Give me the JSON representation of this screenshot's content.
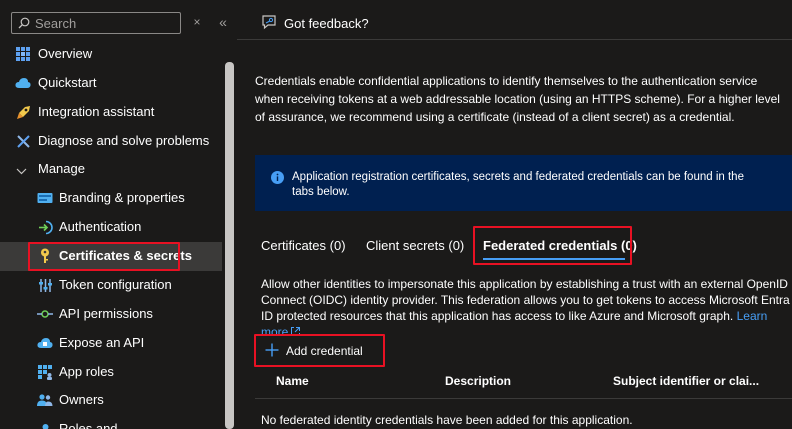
{
  "sidebar": {
    "search_placeholder": "Search",
    "close_glyph": "×",
    "collapse_glyph": "«",
    "items": [
      {
        "label": "Overview"
      },
      {
        "label": "Quickstart"
      },
      {
        "label": "Integration assistant"
      },
      {
        "label": "Diagnose and solve problems"
      },
      {
        "label": "Manage"
      },
      {
        "label": "Branding & properties"
      },
      {
        "label": "Authentication"
      },
      {
        "label": "Certificates & secrets"
      },
      {
        "label": "Token configuration"
      },
      {
        "label": "API permissions"
      },
      {
        "label": "Expose an API"
      },
      {
        "label": "App roles"
      },
      {
        "label": "Owners"
      },
      {
        "label": "Roles and"
      }
    ]
  },
  "main": {
    "feedback_label": "Got feedback?",
    "intro": "Credentials enable confidential applications to identify themselves to the authentication service when receiving tokens at a web addressable location (using an HTTPS scheme). For a higher level of assurance, we recommend using a certificate (instead of a client secret) as a credential.",
    "info_bar": {
      "text": "Application registration certificates, secrets and federated credentials can be found in the tabs below.",
      "close": "✕"
    },
    "tabs": [
      {
        "label": "Certificates (0)"
      },
      {
        "label": "Client secrets (0)"
      },
      {
        "label": "Federated credentials (0)"
      }
    ],
    "federated_description": "Allow other identities to impersonate this application by establishing a trust with an external OpenID Connect (OIDC) identity provider. This federation allows you to get tokens to access Microsoft Entra ID protected resources that this application has access to like Azure and Microsoft graph.",
    "learn_more": "Learn more",
    "add_credential_label": "Add credential",
    "table": {
      "headers": [
        "Name",
        "Description",
        "Subject identifier or clai..."
      ],
      "empty_message": "No federated identity credentials have been added for this application."
    }
  },
  "colors": {
    "background": "#1b1a19",
    "accent": "#479ef5",
    "highlight_box": "#e81123",
    "info_bar": "#002050",
    "selected_nav": "#3b3a39"
  }
}
